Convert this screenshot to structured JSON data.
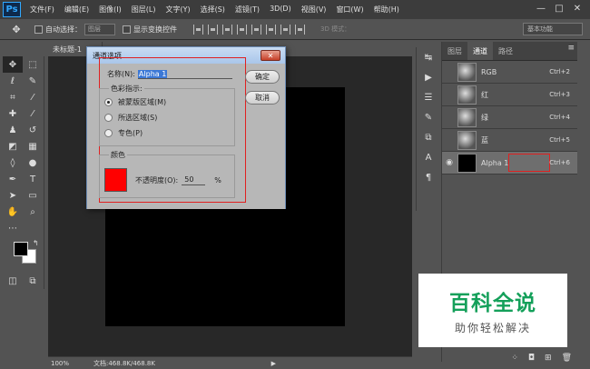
{
  "app": {
    "logo": "Ps"
  },
  "menu": [
    "文件(F)",
    "编辑(E)",
    "图像(I)",
    "图层(L)",
    "文字(Y)",
    "选择(S)",
    "滤镜(T)",
    "3D(D)",
    "视图(V)",
    "窗口(W)",
    "帮助(H)"
  ],
  "window_controls": {
    "minimize": "—",
    "maximize": "□",
    "close": "✕"
  },
  "options": {
    "auto_select_label": "自动选择：",
    "auto_select_value": "图层",
    "transform_label": "显示变换控件",
    "mode3d_label": "3D 模式：",
    "workspace": "基本功能"
  },
  "document": {
    "tab_title": "未标题-1"
  },
  "status": {
    "zoom": "100%",
    "doc_info": "文档:468.8K/468.8K",
    "arrow": "▶"
  },
  "panel": {
    "tabs": [
      "图层",
      "通道",
      "路径"
    ],
    "active_tab": "通道",
    "channels": [
      {
        "name": "RGB",
        "shortcut": "Ctrl+2"
      },
      {
        "name": "红",
        "shortcut": "Ctrl+3"
      },
      {
        "name": "绿",
        "shortcut": "Ctrl+4"
      },
      {
        "name": "蓝",
        "shortcut": "Ctrl+5"
      },
      {
        "name": "Alpha 1",
        "shortcut": "Ctrl+6"
      }
    ]
  },
  "dialog": {
    "title": "通道选项",
    "name_label": "名称(N):",
    "name_value": "Alpha 1",
    "color_indicates_label": "色彩指示:",
    "radio_masked": "被蒙版区域(M)",
    "radio_selected": "所选区域(S)",
    "radio_spot": "专色(P)",
    "color_group_label": "颜色",
    "opacity_label": "不透明度(O):",
    "opacity_value": "50",
    "opacity_unit": "%",
    "ok": "确定",
    "cancel": "取消",
    "close": "✕",
    "swatch_color": "#ff0000"
  },
  "watermark": {
    "title": "百科全说",
    "subtitle": "助你轻松解决"
  }
}
